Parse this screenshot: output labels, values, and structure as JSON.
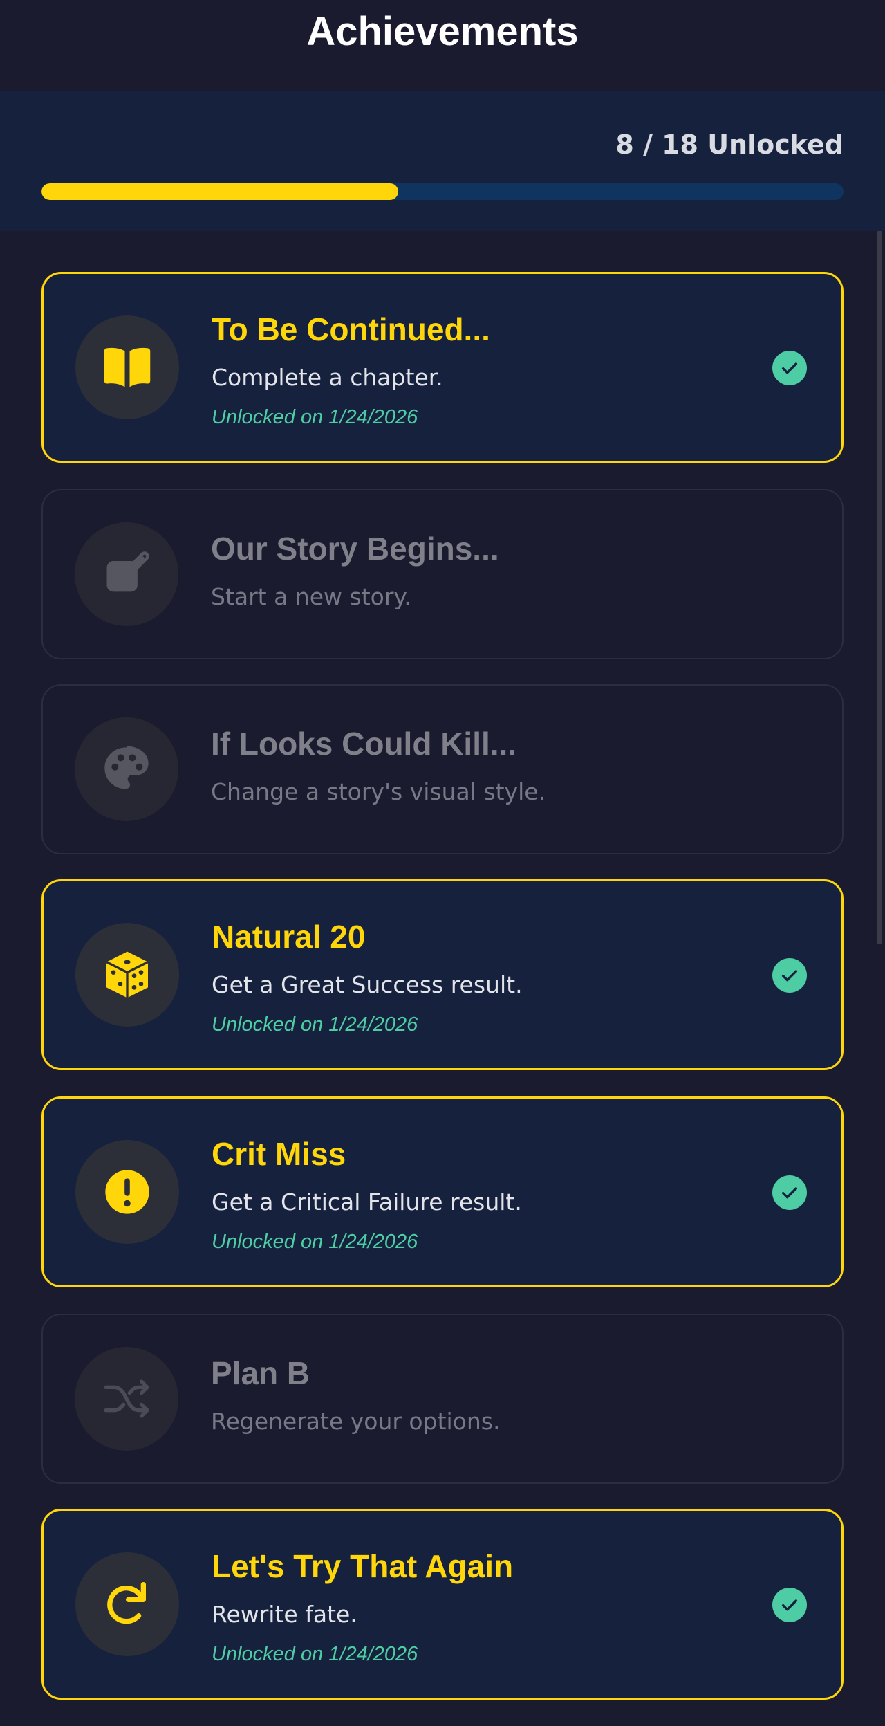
{
  "header": {
    "title": "Achievements"
  },
  "progress": {
    "label": "8 / 18 Unlocked",
    "unlocked": 8,
    "total": 18
  },
  "achievements": [
    {
      "title": "To Be Continued...",
      "description": "Complete a chapter.",
      "unlocked": true,
      "unlocked_label": "Unlocked on 1/24/2026",
      "icon": "open-book-icon"
    },
    {
      "title": "Our Story Begins...",
      "description": "Start a new story.",
      "unlocked": false,
      "icon": "edit-square-icon"
    },
    {
      "title": "If Looks Could Kill...",
      "description": "Change a story's visual style.",
      "unlocked": false,
      "icon": "palette-icon"
    },
    {
      "title": "Natural 20",
      "description": "Get a Great Success result.",
      "unlocked": true,
      "unlocked_label": "Unlocked on 1/24/2026",
      "icon": "dice-icon"
    },
    {
      "title": "Crit Miss",
      "description": "Get a Critical Failure result.",
      "unlocked": true,
      "unlocked_label": "Unlocked on 1/24/2026",
      "icon": "exclamation-icon"
    },
    {
      "title": "Plan B",
      "description": "Regenerate your options.",
      "unlocked": false,
      "icon": "shuffle-icon"
    },
    {
      "title": "Let's Try That Again",
      "description": "Rewrite fate.",
      "unlocked": true,
      "unlocked_label": "Unlocked on 1/24/2026",
      "icon": "redo-icon"
    }
  ],
  "colors": {
    "accent": "#ffd60a",
    "success": "#4ecca3",
    "background": "#1b1b2f",
    "panel": "#16213e",
    "track": "#0f3460"
  }
}
